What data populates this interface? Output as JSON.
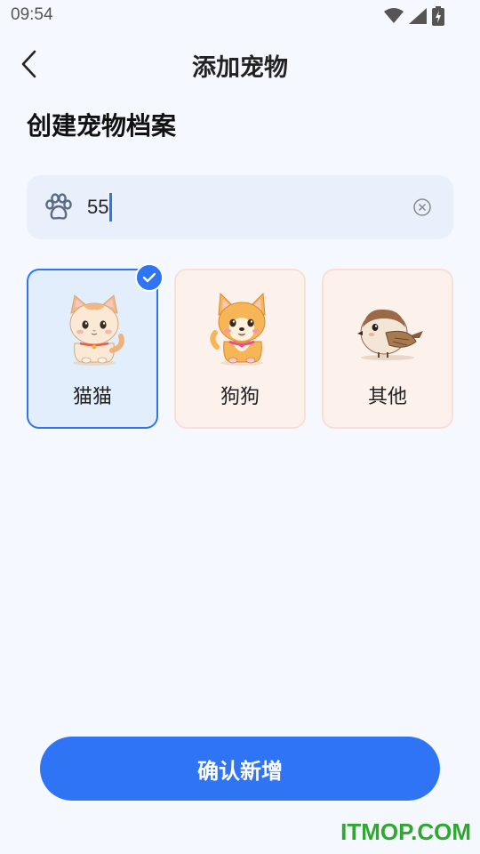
{
  "status_bar": {
    "time": "09:54",
    "icons": [
      "wifi-icon",
      "signal-icon",
      "battery-charging-icon"
    ]
  },
  "nav": {
    "back_icon": "chevron-left-icon",
    "title": "添加宠物"
  },
  "section_title": "创建宠物档案",
  "name_field": {
    "icon": "paw-icon",
    "value": "55",
    "clear_icon": "clear-circle-icon"
  },
  "pet_types": [
    {
      "label": "猫猫",
      "selected": true,
      "icon": "cat-illustration"
    },
    {
      "label": "狗狗",
      "selected": false,
      "icon": "dog-illustration"
    },
    {
      "label": "其他",
      "selected": false,
      "icon": "bird-illustration"
    }
  ],
  "confirm_button": "确认新增",
  "watermark": "ITMOP.COM",
  "colors": {
    "accent": "#2F74F5",
    "background": "#F5F8FE",
    "selected_card": "#E3EEFC",
    "unselected_card": "#FDF1EC"
  }
}
